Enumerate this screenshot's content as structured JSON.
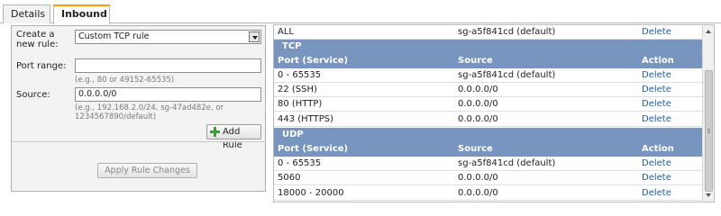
{
  "tabs": [
    "Details",
    "Inbound"
  ],
  "form": {
    "create_label_line1": "Create a",
    "create_label_line2": "new rule:",
    "rule_type": "Custom TCP rule",
    "port_label": "Port range:",
    "port_value": "",
    "port_hint": "(e.g., 80 or 49152-65535)",
    "source_label": "Source:",
    "source_value": "0.0.0.0/0",
    "source_hint_line1": "(e.g., 192.168.2.0/24, sg-47ad482e, or",
    "source_hint_line2": "1234567890/default)",
    "add_rule": "Add Rule",
    "apply": "Apply Rule Changes"
  },
  "rules": {
    "top_row": {
      "port": "ALL",
      "source": "sg-a5f841cd (default)",
      "action": "Delete"
    },
    "columns": {
      "port": "Port (Service)",
      "source": "Source",
      "action": "Action"
    },
    "groups": [
      {
        "name": "TCP",
        "rows": [
          {
            "port": "0 - 65535",
            "source": "sg-a5f841cd (default)",
            "action": "Delete"
          },
          {
            "port": "22 (SSH)",
            "source": "0.0.0.0/0",
            "action": "Delete"
          },
          {
            "port": "80 (HTTP)",
            "source": "0.0.0.0/0",
            "action": "Delete"
          },
          {
            "port": "443 (HTTPS)",
            "source": "0.0.0.0/0",
            "action": "Delete"
          }
        ]
      },
      {
        "name": "UDP",
        "rows": [
          {
            "port": "0 - 65535",
            "source": "sg-a5f841cd (default)",
            "action": "Delete"
          },
          {
            "port": "5060",
            "source": "0.0.0.0/0",
            "action": "Delete"
          },
          {
            "port": "18000 - 20000",
            "source": "0.0.0.0/0",
            "action": "Delete"
          }
        ]
      }
    ]
  },
  "colors": {
    "accent": "#ff9900",
    "header_bg": "#7795be",
    "link": "#1d5fa8",
    "add_icon": "#3aa03a"
  },
  "icons": {
    "add": "plus-icon",
    "select": "chevron-down-icon",
    "scroll_up": "arrow-up-icon",
    "scroll_down": "arrow-down-icon"
  }
}
